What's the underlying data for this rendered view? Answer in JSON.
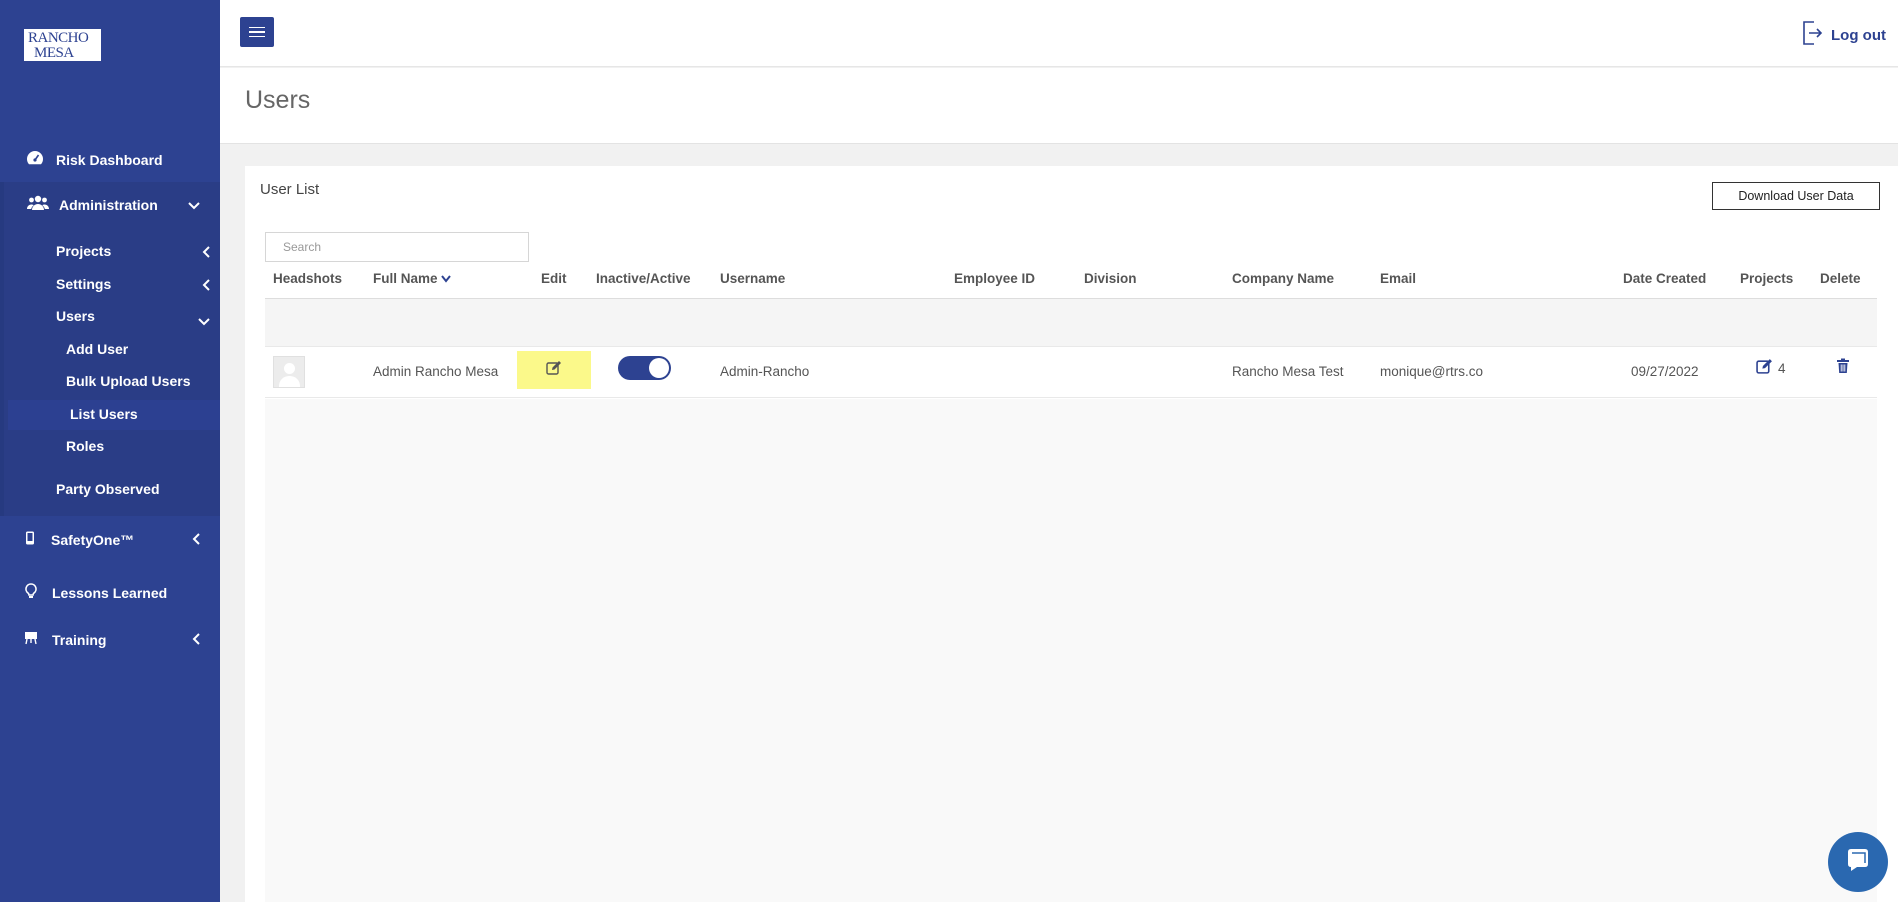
{
  "app": {
    "logo_line1": "RANCHO",
    "logo_line2": "MESA"
  },
  "sidebar": {
    "risk_dashboard": "Risk Dashboard",
    "administration": "Administration",
    "projects": "Projects",
    "settings": "Settings",
    "users": "Users",
    "add_user": "Add User",
    "bulk_upload": "Bulk Upload Users",
    "list_users": "List Users",
    "roles": "Roles",
    "party_observed": "Party Observed",
    "safetyone": "SafetyOne™",
    "lessons_learned": "Lessons Learned",
    "training": "Training"
  },
  "header": {
    "logout": "Log out"
  },
  "page": {
    "title": "Users"
  },
  "card": {
    "title": "User List",
    "download_label": "Download User Data",
    "search_placeholder": "Search"
  },
  "table": {
    "columns": {
      "headshots": "Headshots",
      "full_name": "Full Name",
      "edit": "Edit",
      "inactive_active": "Inactive/Active",
      "username": "Username",
      "employee_id": "Employee ID",
      "division": "Division",
      "company_name": "Company Name",
      "email": "Email",
      "date_created": "Date Created",
      "projects": "Projects",
      "delete": "Delete"
    },
    "rows": [
      {
        "full_name": "Admin Rancho Mesa",
        "active": true,
        "username": "Admin-Rancho",
        "employee_id": "",
        "division": "",
        "company_name": "Rancho Mesa Test",
        "email": "monique@rtrs.co",
        "date_created": "09/27/2022",
        "projects": "4"
      }
    ]
  },
  "colors": {
    "brand": "#2d4291",
    "highlight": "#fbf98a",
    "chat": "#2a68b0"
  },
  "icons": [
    "risk-dashboard-icon",
    "users-group-icon",
    "phone-icon",
    "lightbulb-icon",
    "easel-icon",
    "logout-icon",
    "edit-icon",
    "trash-icon",
    "chat-icon"
  ]
}
